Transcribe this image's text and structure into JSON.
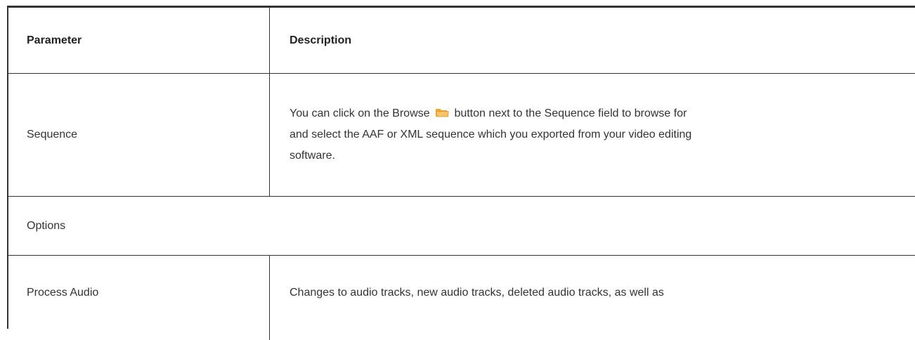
{
  "table": {
    "header": {
      "parameter": "Parameter",
      "description": "Description"
    },
    "rows": [
      {
        "parameter": "Sequence",
        "description_lines": [
          "You can click on the Browse",
          "button next to the Sequence field to browse for",
          "and select the AAF or XML sequence which you exported from your video editing",
          "software."
        ],
        "icon": "folder-icon"
      },
      {
        "section": "Options"
      },
      {
        "parameter": "Process Audio",
        "description": "Changes to audio tracks, new audio tracks, deleted audio tracks, as well as"
      }
    ]
  },
  "colors": {
    "border": "#333333",
    "text": "#333333",
    "folder_icon": "#f5a623"
  }
}
